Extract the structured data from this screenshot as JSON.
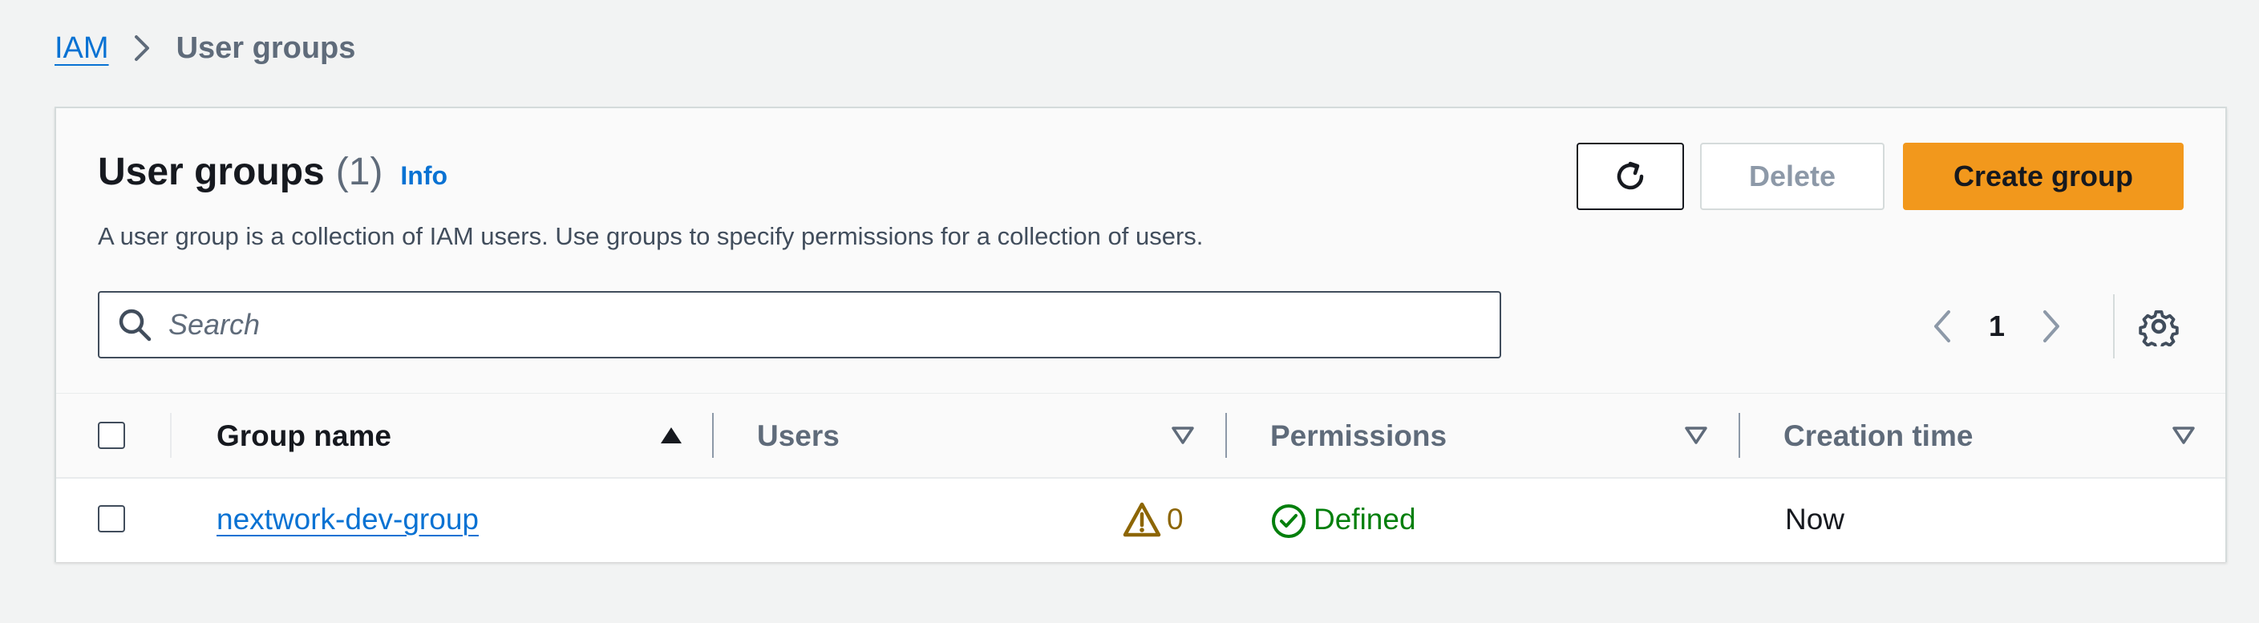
{
  "breadcrumb": {
    "root": "IAM",
    "current": "User groups"
  },
  "header": {
    "title": "User groups",
    "count": "(1)",
    "info": "Info",
    "description": "A user group is a collection of IAM users. Use groups to specify permissions for a collection of users."
  },
  "actions": {
    "refresh_icon": "refresh-icon",
    "delete_label": "Delete",
    "create_label": "Create group"
  },
  "search": {
    "placeholder": "Search",
    "value": ""
  },
  "pagination": {
    "page": "1"
  },
  "table": {
    "columns": [
      "Group name",
      "Users",
      "Permissions",
      "Creation time"
    ],
    "rows": [
      {
        "group_name": "nextwork-dev-group",
        "users": "0",
        "permissions": "Defined",
        "creation_time": "Now"
      }
    ]
  },
  "colors": {
    "accent": "#0972d3",
    "primary_button": "#f2981c",
    "warning": "#8d6605",
    "success": "#037f0c",
    "page_background": "#f2f3f3"
  }
}
